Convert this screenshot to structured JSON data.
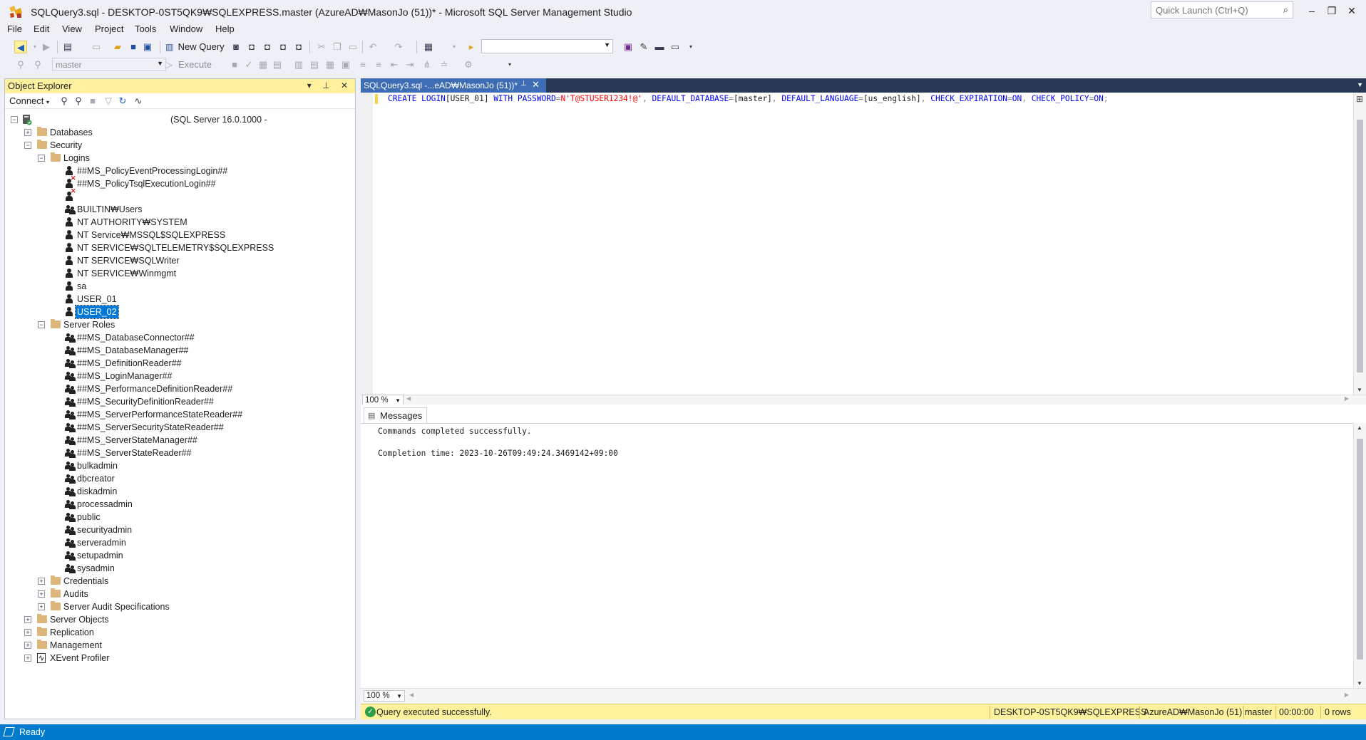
{
  "window": {
    "title": "SQLQuery3.sql - DESKTOP-0ST5QK9₩SQLEXPRESS.master (AzureAD₩MasonJo (51))* - Microsoft SQL Server Management Studio",
    "quick_launch_placeholder": "Quick Launch (Ctrl+Q)"
  },
  "menu": [
    "File",
    "Edit",
    "View",
    "Project",
    "Tools",
    "Window",
    "Help"
  ],
  "toolbar": {
    "new_query_label": "New Query",
    "database_selector": "master",
    "execute_label": "Execute"
  },
  "object_explorer": {
    "title": "Object Explorer",
    "connect_label": "Connect",
    "server_node": "(SQL Server 16.0.1000 -",
    "tree": {
      "databases": "Databases",
      "security": "Security",
      "logins": "Logins",
      "login_items": [
        "##MS_PolicyEventProcessingLogin##",
        "##MS_PolicyTsqlExecutionLogin##",
        "",
        "BUILTIN₩Users",
        "NT AUTHORITY₩SYSTEM",
        "NT Service₩MSSQL$SQLEXPRESS",
        "NT SERVICE₩SQLTELEMETRY$SQLEXPRESS",
        "NT SERVICE₩SQLWriter",
        "NT SERVICE₩Winmgmt",
        "sa",
        "USER_01",
        "USER_02"
      ],
      "server_roles": "Server Roles",
      "role_items": [
        "##MS_DatabaseConnector##",
        "##MS_DatabaseManager##",
        "##MS_DefinitionReader##",
        "##MS_LoginManager##",
        "##MS_PerformanceDefinitionReader##",
        "##MS_SecurityDefinitionReader##",
        "##MS_ServerPerformanceStateReader##",
        "##MS_ServerSecurityStateReader##",
        "##MS_ServerStateManager##",
        "##MS_ServerStateReader##",
        "bulkadmin",
        "dbcreator",
        "diskadmin",
        "processadmin",
        "public",
        "securityadmin",
        "serveradmin",
        "setupadmin",
        "sysadmin"
      ],
      "credentials": "Credentials",
      "audits": "Audits",
      "server_audit_specifications": "Server Audit Specifications",
      "server_objects": "Server Objects",
      "replication": "Replication",
      "management": "Management",
      "xevent_profiler": "XEvent Profiler"
    }
  },
  "editor": {
    "tab_label": "SQLQuery3.sql -...eAD₩MasonJo (51))*",
    "code": {
      "t1": "CREATE LOGIN",
      "t2": "[USER_01] ",
      "t3": "WITH PASSWORD",
      "t4": "=",
      "t5": "N'T@STUSER1234!@'",
      "t6": ", ",
      "t7": "DEFAULT_DATABASE",
      "t8": "=",
      "t9": "[master]",
      "t10": ", ",
      "t11": "DEFAULT_LANGUAGE",
      "t12": "=",
      "t13": "[us_english]",
      "t14": ", ",
      "t15": "CHECK_EXPIRATION",
      "t16": "=",
      "t17": "ON",
      "t18": ", ",
      "t19": "CHECK_POLICY",
      "t20": "=",
      "t21": "ON",
      "t22": ";"
    },
    "zoom": "100 %"
  },
  "results": {
    "tab_label": "Messages",
    "lines": [
      "Commands completed successfully.",
      "Completion time: 2023-10-26T09:49:24.3469142+09:00"
    ],
    "zoom": "100 %"
  },
  "query_status": {
    "message": "Query executed successfully.",
    "server": "DESKTOP-0ST5QK9₩SQLEXPRESS ...",
    "user": "AzureAD₩MasonJo (51)",
    "database": "master",
    "elapsed": "00:00:00",
    "rows": "0 rows"
  },
  "status_bar": {
    "text": "Ready"
  },
  "colors": {
    "accent": "#007acc",
    "tab_active": "#3e6db5",
    "explorer_header": "#fff19d",
    "status_yellow": "#fff29d",
    "keyword": "#0000ff",
    "string": "#ff0000",
    "selection": "#0078d7"
  }
}
